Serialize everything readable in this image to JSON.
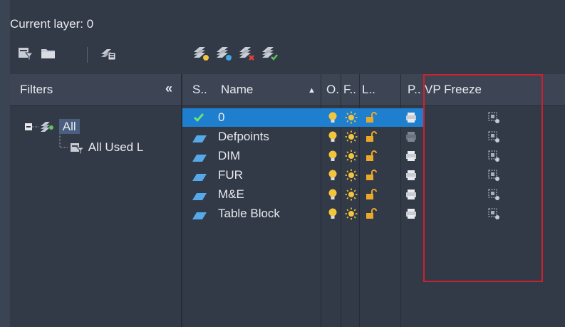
{
  "title": "Current layer: 0",
  "filters": {
    "header": "Filters",
    "collapse_glyph": "«",
    "tree": [
      {
        "label": "All",
        "selected": true
      },
      {
        "label": "All Used L",
        "selected": false
      }
    ]
  },
  "columns": {
    "status": "S..",
    "name": "Name",
    "on": "O.",
    "freeze": "F..",
    "lock": "L..",
    "plot": "P..",
    "vp_freeze": "VP Freeze"
  },
  "layers": [
    {
      "name": "0",
      "current": true,
      "plot_enabled": true
    },
    {
      "name": "Defpoints",
      "current": false,
      "plot_enabled": false
    },
    {
      "name": "DIM",
      "current": false,
      "plot_enabled": true
    },
    {
      "name": "FUR",
      "current": false,
      "plot_enabled": true
    },
    {
      "name": "M&E",
      "current": false,
      "plot_enabled": true
    },
    {
      "name": "Table Block",
      "current": false,
      "plot_enabled": true
    }
  ],
  "icons": {
    "toolbar": [
      "new-property-filter-icon",
      "new-group-filter-icon",
      "layer-states-manager-icon",
      "new-layer-icon",
      "new-layer-vp-frozen-icon",
      "delete-layer-icon",
      "set-current-icon"
    ],
    "on": "lightbulb-icon",
    "freeze": "sun-icon",
    "lock": "unlocked-padlock-icon",
    "plot": "printer-icon",
    "vp_freeze": "vp-freeze-icon"
  },
  "colors": {
    "background": "#3b4453",
    "selected_row": "#1f7fcf",
    "highlight_box": "#d01f2f",
    "bulb": "#f2c53d",
    "sun": "#f2c53d",
    "lock": "#e9a92a"
  }
}
